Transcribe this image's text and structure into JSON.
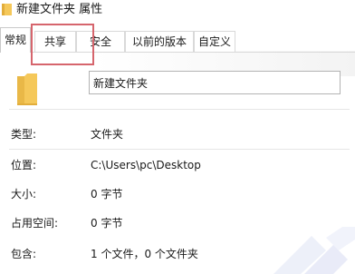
{
  "window": {
    "title": "新建文件夹 属性",
    "folder_icon": "folder-icon"
  },
  "tabs": [
    {
      "label": "常规",
      "selected": true
    },
    {
      "label": "共享",
      "selected": false,
      "highlighted": true
    },
    {
      "label": "安全",
      "selected": false
    },
    {
      "label": "以前的版本",
      "selected": false
    },
    {
      "label": "自定义",
      "selected": false
    }
  ],
  "general": {
    "icon": "folder-icon",
    "name_value": "新建文件夹",
    "rows": [
      {
        "label": "类型:",
        "value": "文件夹"
      },
      {
        "label": "位置:",
        "value": "C:\\Users\\pc\\Desktop"
      },
      {
        "label": "大小:",
        "value": "0 字节"
      },
      {
        "label": "占用空间:",
        "value": "0 字节"
      },
      {
        "label": "包含:",
        "value": "1 个文件，0 个文件夹"
      }
    ]
  },
  "colors": {
    "highlight_box": "#d6656d",
    "folder_yellow": "#f5c85a",
    "folder_shade": "#e2ad3b"
  }
}
